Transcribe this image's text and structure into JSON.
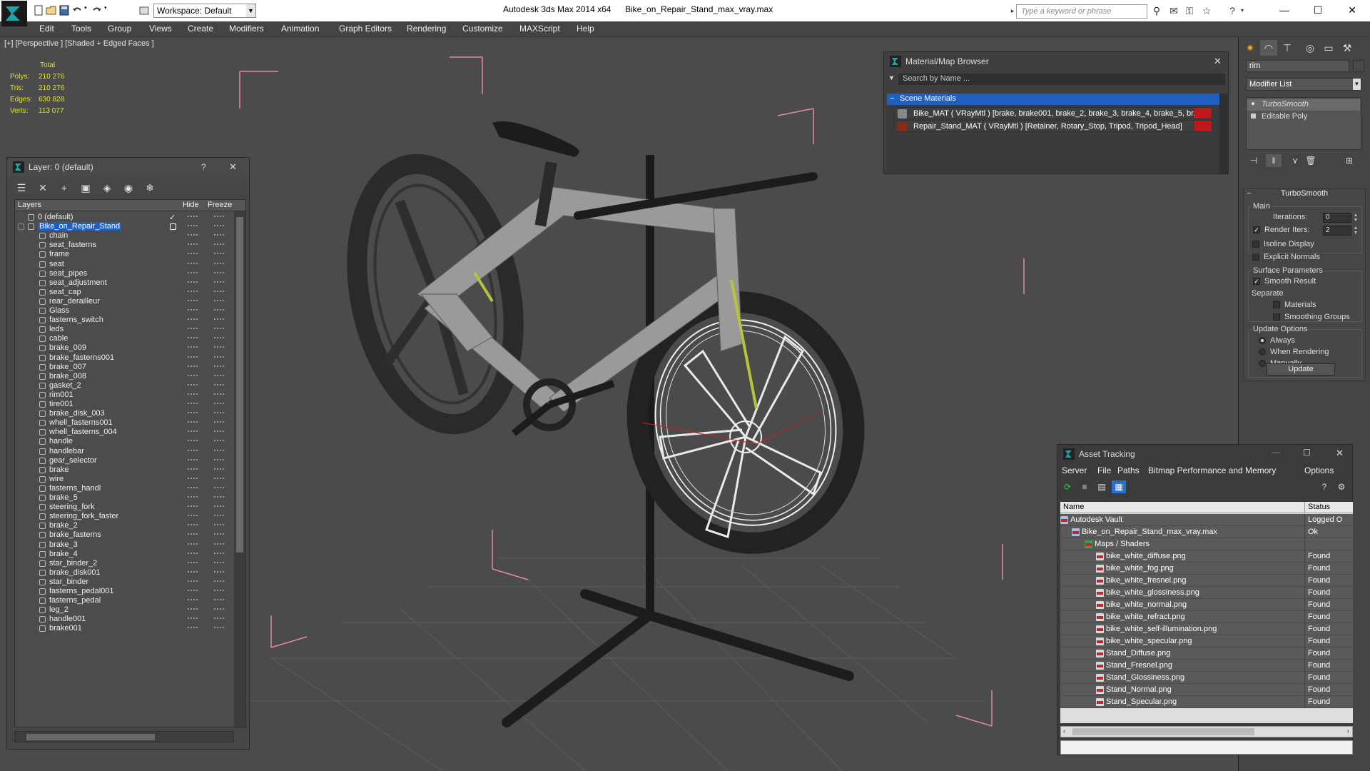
{
  "app": {
    "title": "Autodesk 3ds Max  2014 x64",
    "file": "Bike_on_Repair_Stand_max_vray.max",
    "workspace": "Workspace: Default",
    "search_placeholder": "Type a keyword or phrase"
  },
  "menu": [
    "Edit",
    "Tools",
    "Group",
    "Views",
    "Create",
    "Modifiers",
    "Animation",
    "Graph Editors",
    "Rendering",
    "Customize",
    "MAXScript",
    "Help"
  ],
  "viewport": {
    "label": "[+] [Perspective ] [Shaded + Edged Faces ]",
    "stats": {
      "total_label": "Total",
      "rows": [
        {
          "label": "Polys:",
          "value": "210 276"
        },
        {
          "label": "Tris:",
          "value": "210 276"
        },
        {
          "label": "Edges:",
          "value": "630 828"
        },
        {
          "label": "Verts:",
          "value": "113 077"
        }
      ]
    }
  },
  "layer_window": {
    "title": "Layer: 0 (default)",
    "help": "?",
    "close": "✕",
    "col_layers": "Layers",
    "col_hide": "Hide",
    "col_freeze": "Freeze",
    "layers": [
      {
        "name": "0 (default)",
        "level": 0,
        "current": true
      },
      {
        "name": "Bike_on_Repair_Stand",
        "level": 0,
        "selected": true
      },
      {
        "name": "chain",
        "level": 1
      },
      {
        "name": "seat_fasterns",
        "level": 1
      },
      {
        "name": "frame",
        "level": 1
      },
      {
        "name": "seat",
        "level": 1
      },
      {
        "name": "seat_pipes",
        "level": 1
      },
      {
        "name": "seat_adjustment",
        "level": 1
      },
      {
        "name": "seat_cap",
        "level": 1
      },
      {
        "name": "rear_derailleur",
        "level": 1
      },
      {
        "name": "Glass",
        "level": 1
      },
      {
        "name": "fasterns_switch",
        "level": 1
      },
      {
        "name": "leds",
        "level": 1
      },
      {
        "name": "cable",
        "level": 1
      },
      {
        "name": "brake_009",
        "level": 1
      },
      {
        "name": "brake_fasterns001",
        "level": 1
      },
      {
        "name": "brake_007",
        "level": 1
      },
      {
        "name": "brake_008",
        "level": 1
      },
      {
        "name": "gasket_2",
        "level": 1
      },
      {
        "name": "rim001",
        "level": 1
      },
      {
        "name": "tire001",
        "level": 1
      },
      {
        "name": "brake_disk_003",
        "level": 1
      },
      {
        "name": "whell_fasterns001",
        "level": 1
      },
      {
        "name": "whell_fasterns_004",
        "level": 1
      },
      {
        "name": "handle",
        "level": 1
      },
      {
        "name": "handlebar",
        "level": 1
      },
      {
        "name": "gear_selector",
        "level": 1
      },
      {
        "name": "brake",
        "level": 1
      },
      {
        "name": "wire",
        "level": 1
      },
      {
        "name": "fasterns_handl",
        "level": 1
      },
      {
        "name": "brake_5",
        "level": 1
      },
      {
        "name": "steering_fork",
        "level": 1
      },
      {
        "name": "steering_fork_faster",
        "level": 1
      },
      {
        "name": "brake_2",
        "level": 1
      },
      {
        "name": "brake_fasterns",
        "level": 1
      },
      {
        "name": "brake_3",
        "level": 1
      },
      {
        "name": "brake_4",
        "level": 1
      },
      {
        "name": "star_binder_2",
        "level": 1
      },
      {
        "name": "brake_disk001",
        "level": 1
      },
      {
        "name": "star_binder",
        "level": 1
      },
      {
        "name": "fasterns_pedal001",
        "level": 1
      },
      {
        "name": "fasterns_pedal",
        "level": 1
      },
      {
        "name": "leg_2",
        "level": 1
      },
      {
        "name": "handle001",
        "level": 1
      },
      {
        "name": "brake001",
        "level": 1
      }
    ]
  },
  "material_browser": {
    "title": "Material/Map Browser",
    "search_placeholder": "Search by Name ...",
    "group": "Scene Materials",
    "items": [
      {
        "label": "Bike_MAT  ( VRayMtl ) [brake, brake001, brake_2, brake_3, brake_4, brake_5, br...",
        "swatch": "#888888"
      },
      {
        "label": "Repair_Stand_MAT  ( VRayMtl ) [Retainer, Rotary_Stop, Tripod, Tripod_Head]",
        "swatch": "#8a2a1a"
      }
    ]
  },
  "command_panel": {
    "object_name": "rim",
    "modifier_list": "Modifier List",
    "stack": [
      {
        "name": "TurboSmooth",
        "italic": true
      },
      {
        "name": "Editable Poly",
        "italic": false
      }
    ],
    "turbosmooth": {
      "title": "TurboSmooth",
      "main_label": "Main",
      "iterations_label": "Iterations:",
      "iterations": "0",
      "render_iters_label": "Render Iters:",
      "render_iters": "2",
      "isoline_label": "Isoline Display",
      "explicit_normals_label": "Explicit Normals",
      "surface_params_label": "Surface Parameters",
      "smooth_result_label": "Smooth Result",
      "separate_label": "Separate",
      "materials_label": "Materials",
      "smoothing_groups_label": "Smoothing Groups",
      "update_options_label": "Update Options",
      "always_label": "Always",
      "when_rendering_label": "When Rendering",
      "manually_label": "Manually",
      "update_button": "Update"
    }
  },
  "asset_tracking": {
    "title": "Asset Tracking",
    "menu": [
      "Server",
      "File",
      "Paths",
      "Bitmap Performance and Memory",
      "Options"
    ],
    "col_name": "Name",
    "col_status": "Status",
    "rows": [
      {
        "name": "Autodesk Vault",
        "status": "Logged O",
        "level": 0,
        "icon": "vault"
      },
      {
        "name": "Bike_on_Repair_Stand_max_vray.max",
        "status": "Ok",
        "level": 1,
        "icon": "max"
      },
      {
        "name": "Maps / Shaders",
        "status": "",
        "level": 2,
        "icon": "maps"
      },
      {
        "name": "bike_white_diffuse.png",
        "status": "Found",
        "level": 3,
        "icon": "png"
      },
      {
        "name": "bike_white_fog.png",
        "status": "Found",
        "level": 3,
        "icon": "png"
      },
      {
        "name": "bike_white_fresnel.png",
        "status": "Found",
        "level": 3,
        "icon": "png"
      },
      {
        "name": "bike_white_glossiness.png",
        "status": "Found",
        "level": 3,
        "icon": "png"
      },
      {
        "name": "bike_white_normal.png",
        "status": "Found",
        "level": 3,
        "icon": "png"
      },
      {
        "name": "bike_white_refract.png",
        "status": "Found",
        "level": 3,
        "icon": "png"
      },
      {
        "name": "bike_white_self-illumination.png",
        "status": "Found",
        "level": 3,
        "icon": "png"
      },
      {
        "name": "bike_white_specular.png",
        "status": "Found",
        "level": 3,
        "icon": "png"
      },
      {
        "name": "Stand_Diffuse.png",
        "status": "Found",
        "level": 3,
        "icon": "png"
      },
      {
        "name": "Stand_Fresnel.png",
        "status": "Found",
        "level": 3,
        "icon": "png"
      },
      {
        "name": "Stand_Glossiness.png",
        "status": "Found",
        "level": 3,
        "icon": "png"
      },
      {
        "name": "Stand_Normal.png",
        "status": "Found",
        "level": 3,
        "icon": "png"
      },
      {
        "name": "Stand_Specular.png",
        "status": "Found",
        "level": 3,
        "icon": "png"
      }
    ]
  },
  "colors": {
    "selection_blue": "#1f5fc0",
    "stats_yellow": "#e6e60a",
    "bbox_pink": "#e08aa8",
    "viewport_bg": "#4b4b4b"
  }
}
